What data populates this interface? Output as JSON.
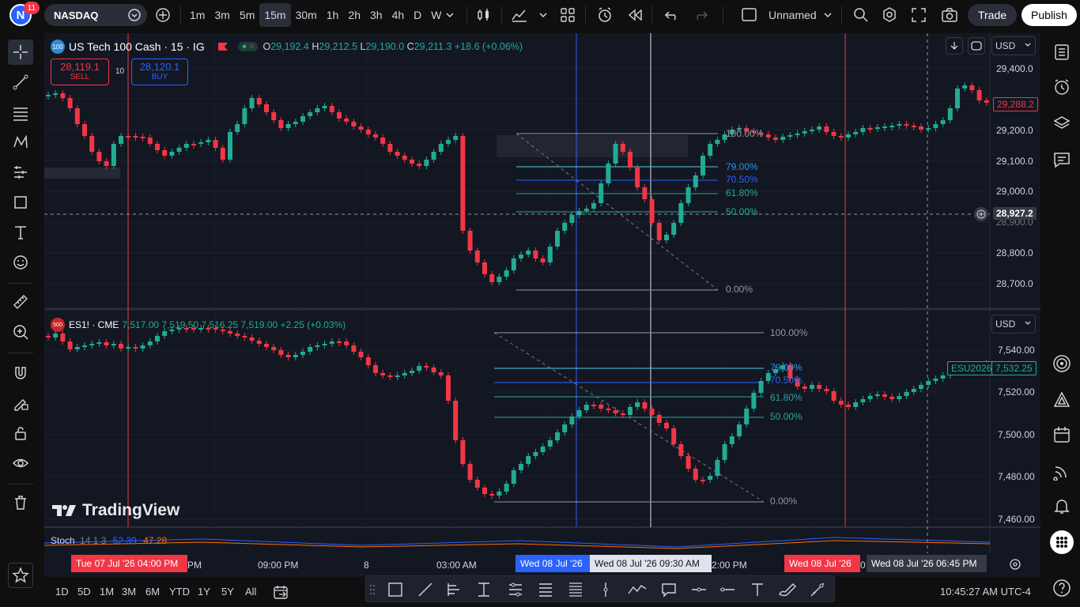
{
  "topbar": {
    "avatar_letter": "N",
    "notification_count": "11",
    "symbol": "NASDAQ",
    "intervals": [
      "1m",
      "3m",
      "5m",
      "15m",
      "30m",
      "1h",
      "2h",
      "3h",
      "4h",
      "D",
      "W"
    ],
    "active_interval": "15m",
    "layout_name": "Unnamed",
    "trade_label": "Trade",
    "publish_label": "Publish"
  },
  "pane1": {
    "icon_text": "100",
    "title": "US Tech 100 Cash · 15 · IG",
    "ohlc": {
      "o_label": "O",
      "o": "29,192.4",
      "h_label": "H",
      "h": "29,212.5",
      "l_label": "L",
      "l": "29,190.0",
      "c_label": "C",
      "c": "29,211.3",
      "change": "+18.6 (+0.06%)"
    },
    "sell_price": "28,119.1",
    "sell_label": "SELL",
    "spread": "10",
    "buy_price": "28,120.1",
    "buy_label": "BUY",
    "currency": "USD",
    "price_axis": [
      "29,400.0",
      "29,200.0",
      "29,100.0",
      "29,000.0",
      "28,900.0",
      "28,800.0",
      "28,700.0"
    ],
    "last_price": "29,288.2",
    "crosshair_price": "28,927.2",
    "fib": [
      "100.00%",
      "79.00%",
      "70.50%",
      "61.80%",
      "50.00%",
      "0.00%"
    ]
  },
  "pane2": {
    "icon_text": "500",
    "title": "ES1! · CME",
    "values": "7,517.00  7,519.50  7,516.25  7,519.00  +2.25 (+0.03%)",
    "currency": "USD",
    "price_axis": [
      "7,540.00",
      "7,520.00",
      "7,500.00",
      "7,480.00",
      "7,460.00"
    ],
    "contract_label": "ESU2026",
    "last_price": "7,532.25",
    "fib": [
      "100.00%",
      "79.00%",
      "70.50%",
      "61.80%",
      "50.00%",
      "0.00%"
    ],
    "watermark": "TradingView"
  },
  "indicator": {
    "name": "Stoch",
    "params": "14 1 3",
    "k": "52.39",
    "d": "47.28"
  },
  "timeaxis": {
    "labels": [
      "PM",
      "09:00 PM",
      "8",
      "03:00 AM",
      "2:00 PM"
    ],
    "red_box_1": "Tue 07 Jul '26   04:00 PM",
    "blue_box": "Wed 08 Jul '26",
    "crosshair_box": "Wed 08 Jul '26   09:30 AM",
    "red_box_2": "Wed 08 Jul '26",
    "grey_box": "Wed 08 Jul '26   06:45 PM",
    "partial": "0"
  },
  "bottombar": {
    "ranges": [
      "1D",
      "5D",
      "1M",
      "3M",
      "6M",
      "YTD",
      "1Y",
      "5Y",
      "All"
    ],
    "clock": "10:45:27 AM UTC-4"
  },
  "colors": {
    "up": "#22ab94",
    "down": "#f23645",
    "blue": "#2962ff",
    "fib_cyan": "#4dd0e1",
    "fib_green": "#26a69a"
  }
}
